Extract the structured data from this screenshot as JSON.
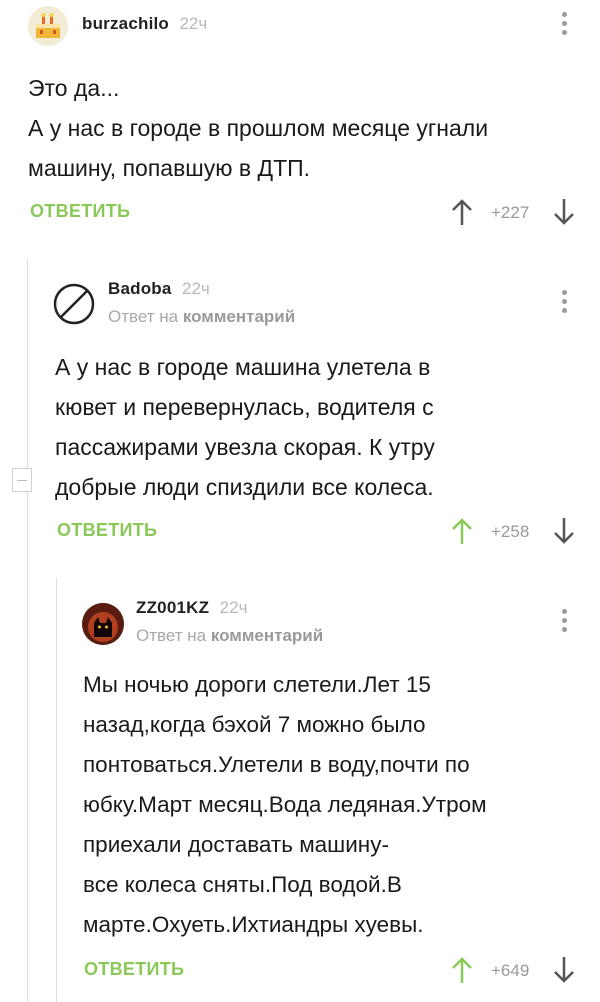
{
  "comments": [
    {
      "username": "burzachilo",
      "time": "22ч",
      "text_lines": [
        "Это да...",
        "А у нас в городе в прошлом месяце угнали",
        "машину, попавшую в ДТП."
      ],
      "reply_label": "ОТВЕТИТЬ",
      "rating": "+227",
      "avatar_icon": "cake-avatar"
    },
    {
      "username": "Badoba",
      "time": "22ч",
      "reply_prefix": "Ответ на",
      "reply_target": "комментарий",
      "text_lines": [
        "А у нас в городе машина улетела в",
        "кювет и перевернулась, водителя с",
        "пассажирами увезла скорая. К утру",
        "добрые люди спиздили все колеса."
      ],
      "reply_label": "ОТВЕТИТЬ",
      "rating": "+258",
      "avatar_icon": "no-avatar"
    },
    {
      "username": "ZZ001KZ",
      "time": "22ч",
      "reply_prefix": "Ответ на",
      "reply_target": "комментарий",
      "text_lines": [
        "Мы ночью дороги слетели.Лет 15",
        "назад,когда бэхой 7 можно было",
        "понтоваться.Улетели в воду,почти по",
        "юбку.Март месяц.Вода ледяная.Утром",
        "приехали доставать машину-",
        "все колеса сняты.Под водой.В",
        "марте.Охуеть.Ихтиандры хуевы."
      ],
      "reply_label": "ОТВЕТИТЬ",
      "rating": "+649",
      "avatar_icon": "cat-avatar"
    }
  ],
  "colors": {
    "accent": "#8ac858",
    "muted": "#9a9a9a",
    "thread": "#dedede"
  }
}
